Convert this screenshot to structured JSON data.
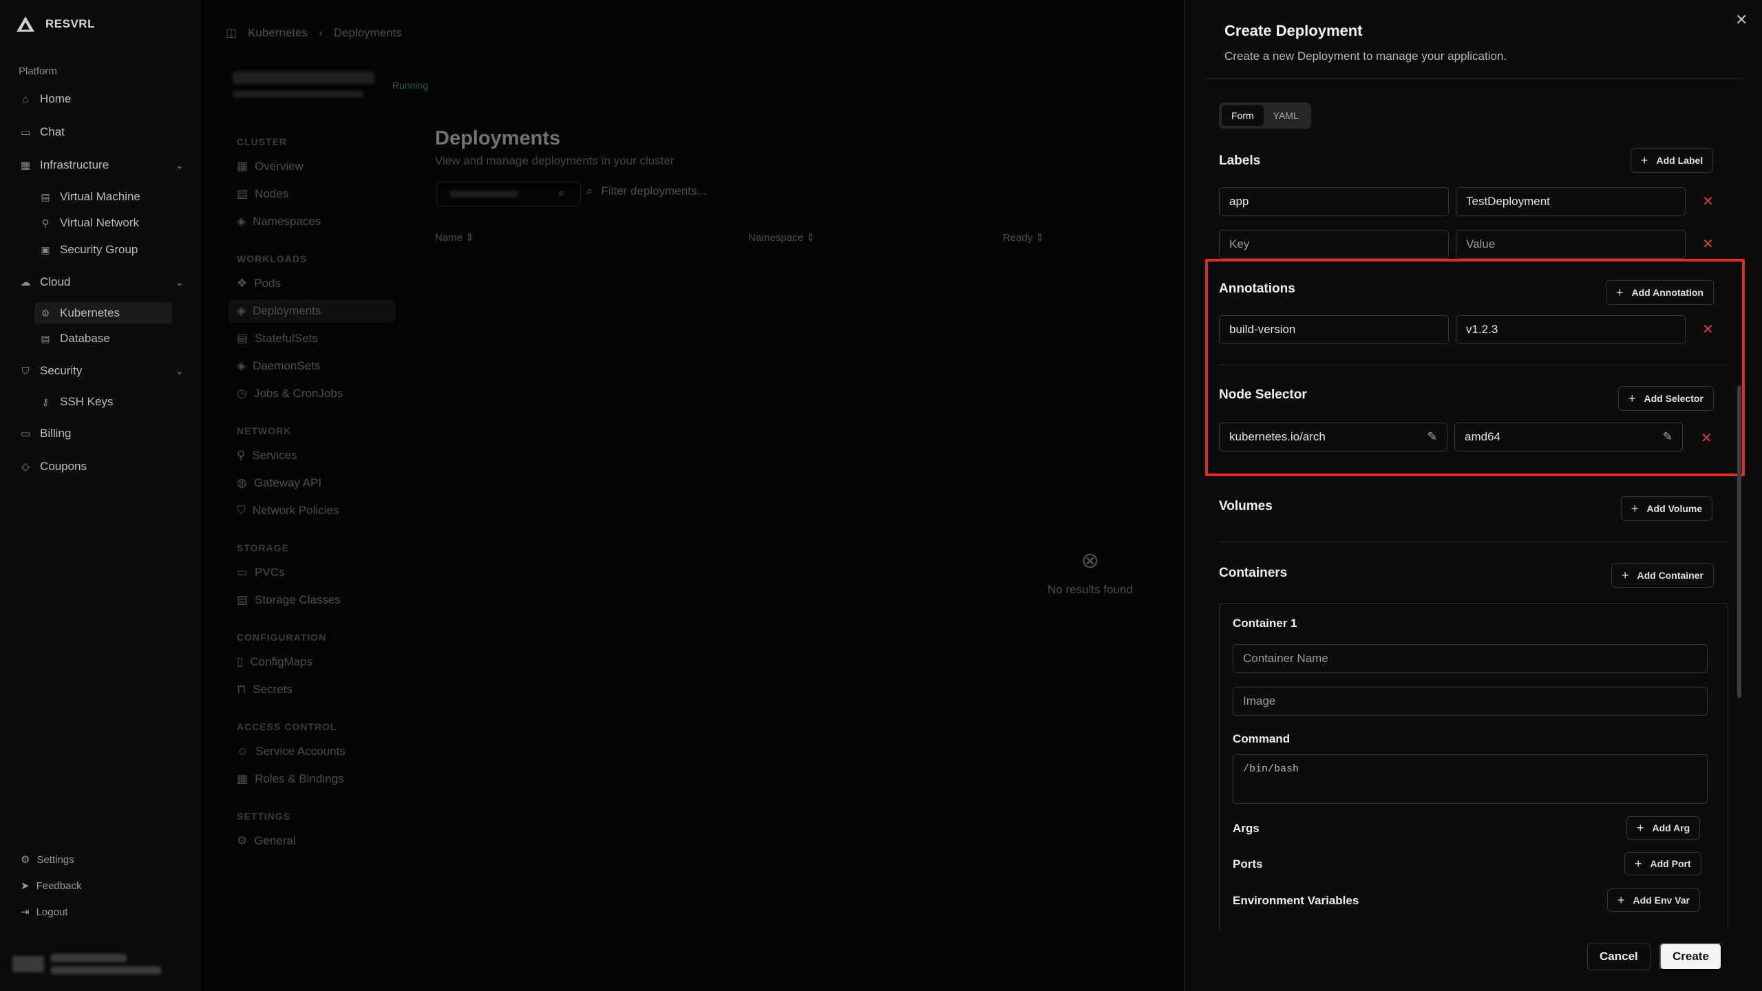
{
  "brand": {
    "name": "RESVRL"
  },
  "sidebar": {
    "section": "Platform",
    "items": [
      {
        "label": "Home",
        "icon": "home-icon"
      },
      {
        "label": "Chat",
        "icon": "chat-icon"
      },
      {
        "label": "Infrastructure",
        "icon": "grid-icon"
      },
      {
        "label": "Virtual Machine",
        "icon": "server-icon"
      },
      {
        "label": "Virtual Network",
        "icon": "network-icon"
      },
      {
        "label": "Security Group",
        "icon": "shield-box-icon"
      },
      {
        "label": "Cloud",
        "icon": "cloud-icon"
      },
      {
        "label": "Kubernetes",
        "icon": "kubernetes-icon"
      },
      {
        "label": "Database",
        "icon": "database-icon"
      },
      {
        "label": "Security",
        "icon": "shield-icon"
      },
      {
        "label": "SSH Keys",
        "icon": "key-icon"
      },
      {
        "label": "Billing",
        "icon": "card-icon"
      },
      {
        "label": "Coupons",
        "icon": "tag-icon"
      }
    ],
    "footer": [
      "Settings",
      "Feedback",
      "Logout"
    ]
  },
  "main": {
    "breadcrumb": [
      "Kubernetes",
      "Deployments"
    ],
    "cluster_status": "Running",
    "subnav": {
      "cluster_head": "CLUSTER",
      "cluster": [
        "Overview",
        "Nodes",
        "Namespaces"
      ],
      "workloads_head": "WORKLOADS",
      "workloads": [
        "Pods",
        "Deployments",
        "StatefulSets",
        "DaemonSets",
        "Jobs & CronJobs"
      ],
      "network_head": "NETWORK",
      "network": [
        "Services",
        "Gateway API",
        "Network Policies"
      ],
      "storage_head": "STORAGE",
      "storage": [
        "PVCs",
        "Storage Classes"
      ],
      "config_head": "CONFIGURATION",
      "config": [
        "ConfigMaps",
        "Secrets"
      ],
      "access_head": "ACCESS CONTROL",
      "access": [
        "Service Accounts",
        "Roles & Bindings"
      ],
      "settings_head": "SETTINGS",
      "settings": [
        "General"
      ]
    },
    "title": "Deployments",
    "subtitle": "View and manage deployments in your cluster",
    "filter_placeholder": "Filter deployments...",
    "columns": [
      "Name",
      "Namespace",
      "Ready"
    ],
    "empty": "No results found"
  },
  "panel": {
    "title": "Create Deployment",
    "description": "Create a new Deployment to manage your application.",
    "tabs": [
      "Form",
      "YAML"
    ],
    "labels": {
      "title": "Labels",
      "add": "Add Label",
      "rows": [
        {
          "key": "app",
          "value": "TestDeployment"
        },
        {
          "key_placeholder": "Key",
          "value_placeholder": "Value"
        }
      ]
    },
    "annotations": {
      "title": "Annotations",
      "add": "Add Annotation",
      "rows": [
        {
          "key": "build-version",
          "value": "v1.2.3"
        }
      ]
    },
    "node_selector": {
      "title": "Node Selector",
      "add": "Add Selector",
      "rows": [
        {
          "key": "kubernetes.io/arch",
          "value": "amd64"
        }
      ]
    },
    "volumes": {
      "title": "Volumes",
      "add": "Add Volume"
    },
    "containers": {
      "title": "Containers",
      "add": "Add Container",
      "container_title": "Container 1",
      "name_placeholder": "Container Name",
      "image_placeholder": "Image",
      "command_label": "Command",
      "command_placeholder": "/bin/bash",
      "args_label": "Args",
      "args_add": "Add Arg",
      "ports_label": "Ports",
      "ports_add": "Add Port",
      "env_label": "Environment Variables",
      "env_add": "Add Env Var"
    },
    "cancel": "Cancel",
    "create": "Create"
  },
  "colors": {
    "accent_red": "#e02b2b",
    "running_green": "#3fae5a"
  }
}
